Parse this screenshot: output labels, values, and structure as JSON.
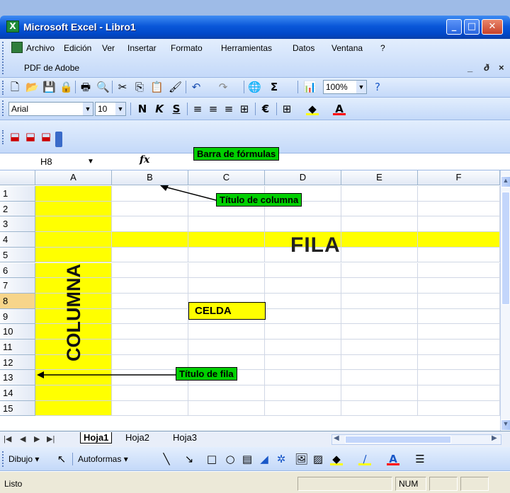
{
  "window": {
    "title": "Microsoft Excel - Libro1",
    "app_icon": "X"
  },
  "menu": {
    "items": [
      "Archivo",
      "Edición",
      "Ver",
      "Insertar",
      "Formato",
      "Herramientas",
      "Datos",
      "Ventana",
      "?"
    ],
    "second_row": "PDF de Adobe",
    "doc_controls": [
      "_",
      "ð",
      "×"
    ]
  },
  "standard_toolbar": {
    "zoom": "100%"
  },
  "format_toolbar": {
    "font": "Arial",
    "size": "10",
    "bold": "N",
    "italic": "K",
    "underline": "S",
    "currency": "€"
  },
  "formula_bar": {
    "name_box": "H8",
    "fx": "fx"
  },
  "annotations": {
    "formula_bar": "Barra de fórmulas",
    "column_title": "Título de columna",
    "row_title": "Título de fila",
    "fila": "FILA",
    "columna": "COLUMNA",
    "celda": "CELDA"
  },
  "grid": {
    "columns": [
      "A",
      "B",
      "C",
      "D",
      "E",
      "F"
    ],
    "rows": [
      "1",
      "2",
      "3",
      "4",
      "5",
      "6",
      "7",
      "8",
      "9",
      "10",
      "11",
      "12",
      "13",
      "14",
      "15"
    ],
    "selected_row": "8",
    "highlight_color": "#ffff00"
  },
  "sheets": {
    "tabs": [
      "Hoja1",
      "Hoja2",
      "Hoja3"
    ],
    "active": "Hoja1"
  },
  "draw_toolbar": {
    "dibujo": "Dibujo",
    "autoformas": "Autoformas"
  },
  "status_bar": {
    "text": "Listo",
    "num": "NUM"
  },
  "colors": {
    "title_blue": "#0a57d9",
    "callout_green": "#00d000",
    "cell_yellow": "#ffff00"
  }
}
